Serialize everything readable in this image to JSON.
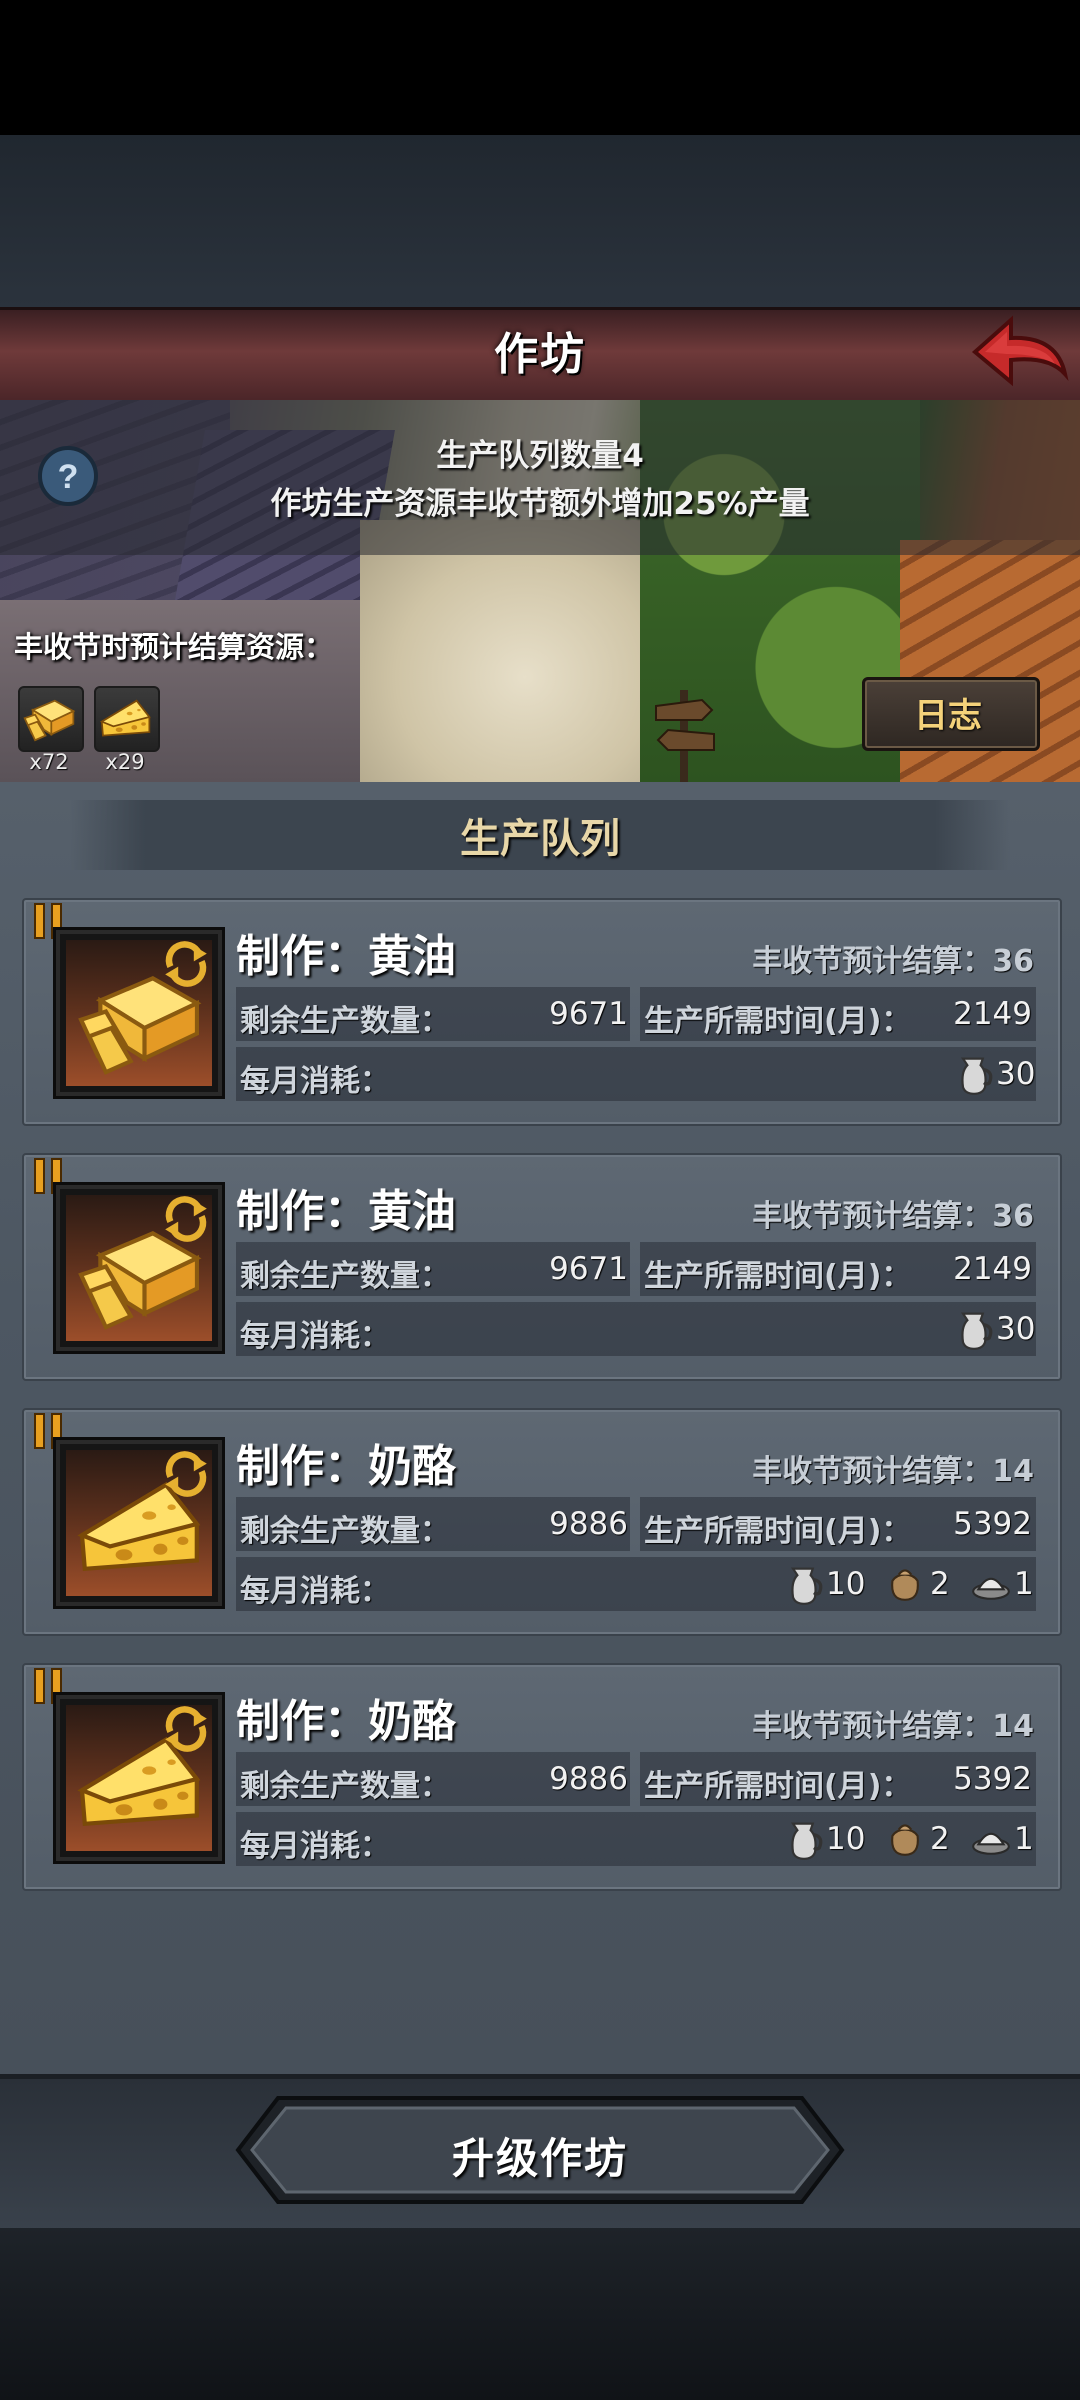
{
  "header": {
    "title": "作坊"
  },
  "info": {
    "queue_count": "生产队列数量4",
    "festival_bonus": "作坊生产资源丰收节额外增加25%产量"
  },
  "settlement": {
    "label": "丰收节时预计结算资源：",
    "items": [
      {
        "icon": "butter-icon",
        "count": "x72"
      },
      {
        "icon": "cheese-icon",
        "count": "x29"
      }
    ]
  },
  "log_button": {
    "label": "日志"
  },
  "section": {
    "title": "生产队列"
  },
  "queue": [
    {
      "title": "制作：黄油",
      "product_icon": "butter-icon",
      "settle": "丰收节预计结算：36",
      "remain_label": "剩余生产数量：",
      "remain": "9671",
      "time_label": "生产所需时间(月)：",
      "time": "2149",
      "consume_label": "每月消耗：",
      "consume": [
        {
          "icon": "milk-jug-icon",
          "value": "30"
        }
      ]
    },
    {
      "title": "制作：黄油",
      "product_icon": "butter-icon",
      "settle": "丰收节预计结算：36",
      "remain_label": "剩余生产数量：",
      "remain": "9671",
      "time_label": "生产所需时间(月)：",
      "time": "2149",
      "consume_label": "每月消耗：",
      "consume": [
        {
          "icon": "milk-jug-icon",
          "value": "30"
        }
      ]
    },
    {
      "title": "制作：奶酪",
      "product_icon": "cheese-icon",
      "settle": "丰收节预计结算：14",
      "remain_label": "剩余生产数量：",
      "remain": "9886",
      "time_label": "生产所需时间(月)：",
      "time": "5392",
      "consume_label": "每月消耗：",
      "consume": [
        {
          "icon": "milk-jug-icon",
          "value": "10"
        },
        {
          "icon": "sack-icon",
          "value": "2"
        },
        {
          "icon": "salt-icon",
          "value": "1"
        }
      ]
    },
    {
      "title": "制作：奶酪",
      "product_icon": "cheese-icon",
      "settle": "丰收节预计结算：14",
      "remain_label": "剩余生产数量：",
      "remain": "9886",
      "time_label": "生产所需时间(月)：",
      "time": "5392",
      "consume_label": "每月消耗：",
      "consume": [
        {
          "icon": "milk-jug-icon",
          "value": "10"
        },
        {
          "icon": "sack-icon",
          "value": "2"
        },
        {
          "icon": "salt-icon",
          "value": "1"
        }
      ]
    }
  ],
  "footer": {
    "upgrade_label": "升级作坊"
  },
  "colors": {
    "accent_gold": "#f5d27a",
    "title_bar": "#6f3a3a",
    "panel": "#535d68"
  }
}
